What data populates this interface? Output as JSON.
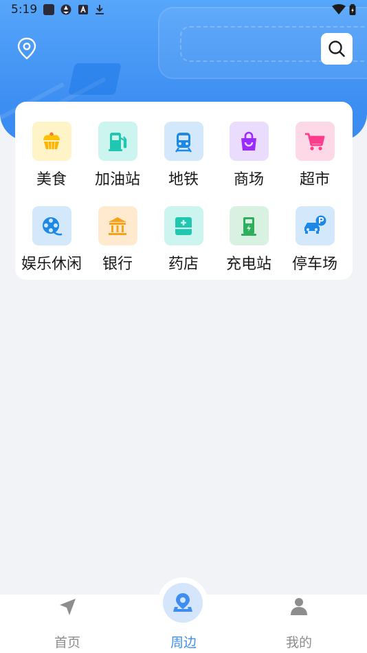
{
  "status_bar": {
    "time": "5:19"
  },
  "header": {
    "location_icon": "map-pin-icon",
    "search_icon": "search-icon",
    "banner_color": "#3e8ff2"
  },
  "categories": [
    {
      "label": "美食",
      "icon": "food-icon",
      "bg": "#fff3c8",
      "fg": "#ffc107"
    },
    {
      "label": "加油站",
      "icon": "gas-station-icon",
      "bg": "#cdf5ef",
      "fg": "#1fc7b0"
    },
    {
      "label": "地铁",
      "icon": "subway-icon",
      "bg": "#d3e9fb",
      "fg": "#1e88e5"
    },
    {
      "label": "商场",
      "icon": "shopping-bag-icon",
      "bg": "#eadcfd",
      "fg": "#9c2bff"
    },
    {
      "label": "超市",
      "icon": "shopping-cart-icon",
      "bg": "#fdd9e7",
      "fg": "#ff3c8c"
    },
    {
      "label": "娱乐休闲",
      "icon": "film-reel-icon",
      "bg": "#d3e9fb",
      "fg": "#1e88e5"
    },
    {
      "label": "银行",
      "icon": "bank-icon",
      "bg": "#ffe9cf",
      "fg": "#f7a21b"
    },
    {
      "label": "药店",
      "icon": "pharmacy-icon",
      "bg": "#cdf5ef",
      "fg": "#1fc7b0"
    },
    {
      "label": "充电站",
      "icon": "charging-station-icon",
      "bg": "#d8f1e0",
      "fg": "#2fae5e"
    },
    {
      "label": "停车场",
      "icon": "parking-icon",
      "bg": "#d3e9fb",
      "fg": "#1e88e5"
    }
  ],
  "bottom_nav": {
    "items": [
      {
        "label": "首页",
        "icon": "navigation-arrow-icon",
        "active": false
      },
      {
        "label": "周边",
        "icon": "nearby-pin-icon",
        "active": true
      },
      {
        "label": "我的",
        "icon": "person-icon",
        "active": false
      }
    ],
    "active_color": "#3d8ef0",
    "inactive_color": "#8d8d8d"
  }
}
